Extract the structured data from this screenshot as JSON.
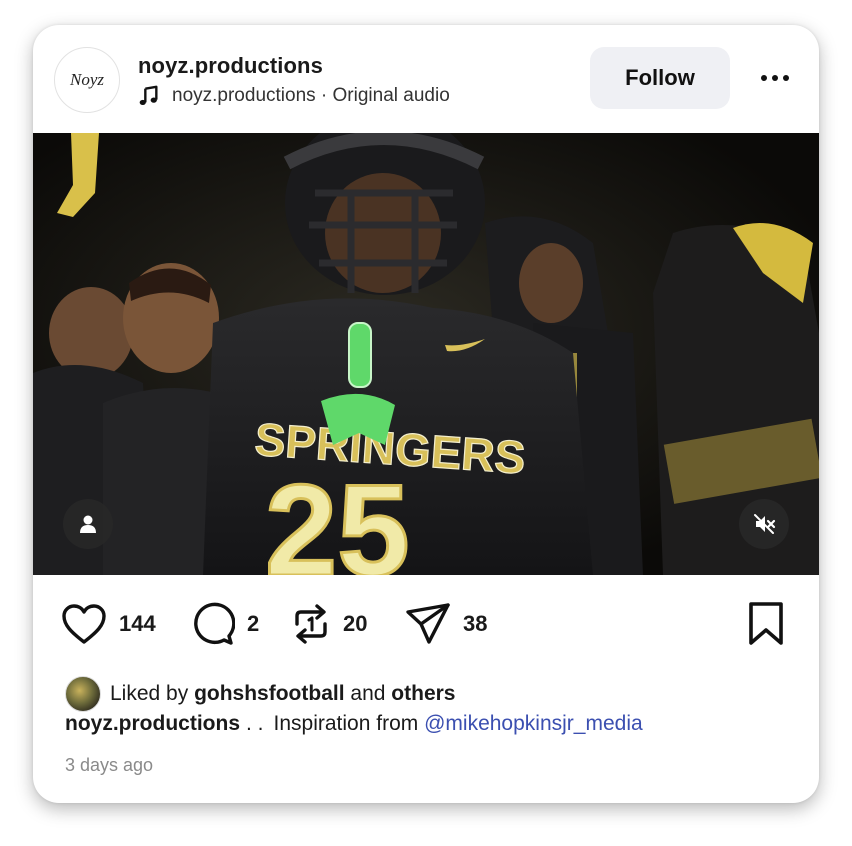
{
  "post": {
    "avatar_text": "Noyz",
    "username": "noyz.productions",
    "audio_label": "noyz.productions · Original audio",
    "follow_label": "Follow",
    "jersey_text": "SPRINGERS",
    "jersey_number": "25"
  },
  "actions": {
    "likes": "144",
    "comments": "2",
    "reposts": "20",
    "shares": "38"
  },
  "liked_by": {
    "prefix": "Liked by",
    "user": "gohshsfootball",
    "connector": "and",
    "others": "others"
  },
  "caption": {
    "username": "noyz.productions",
    "dots": ". .",
    "text": "Inspiration from",
    "mention": "@mikehopkinsjr_media"
  },
  "timestamp": "3 days ago",
  "colors": {
    "jersey_gold": "#d8c05a",
    "mouthguard_green": "#5fd86a",
    "mention_blue": "#3b4fb0"
  },
  "icons": [
    "music-note-icon",
    "more-options-icon",
    "user-tag-icon",
    "mute-icon",
    "heart-icon",
    "comment-icon",
    "repost-icon",
    "share-icon",
    "bookmark-icon"
  ]
}
